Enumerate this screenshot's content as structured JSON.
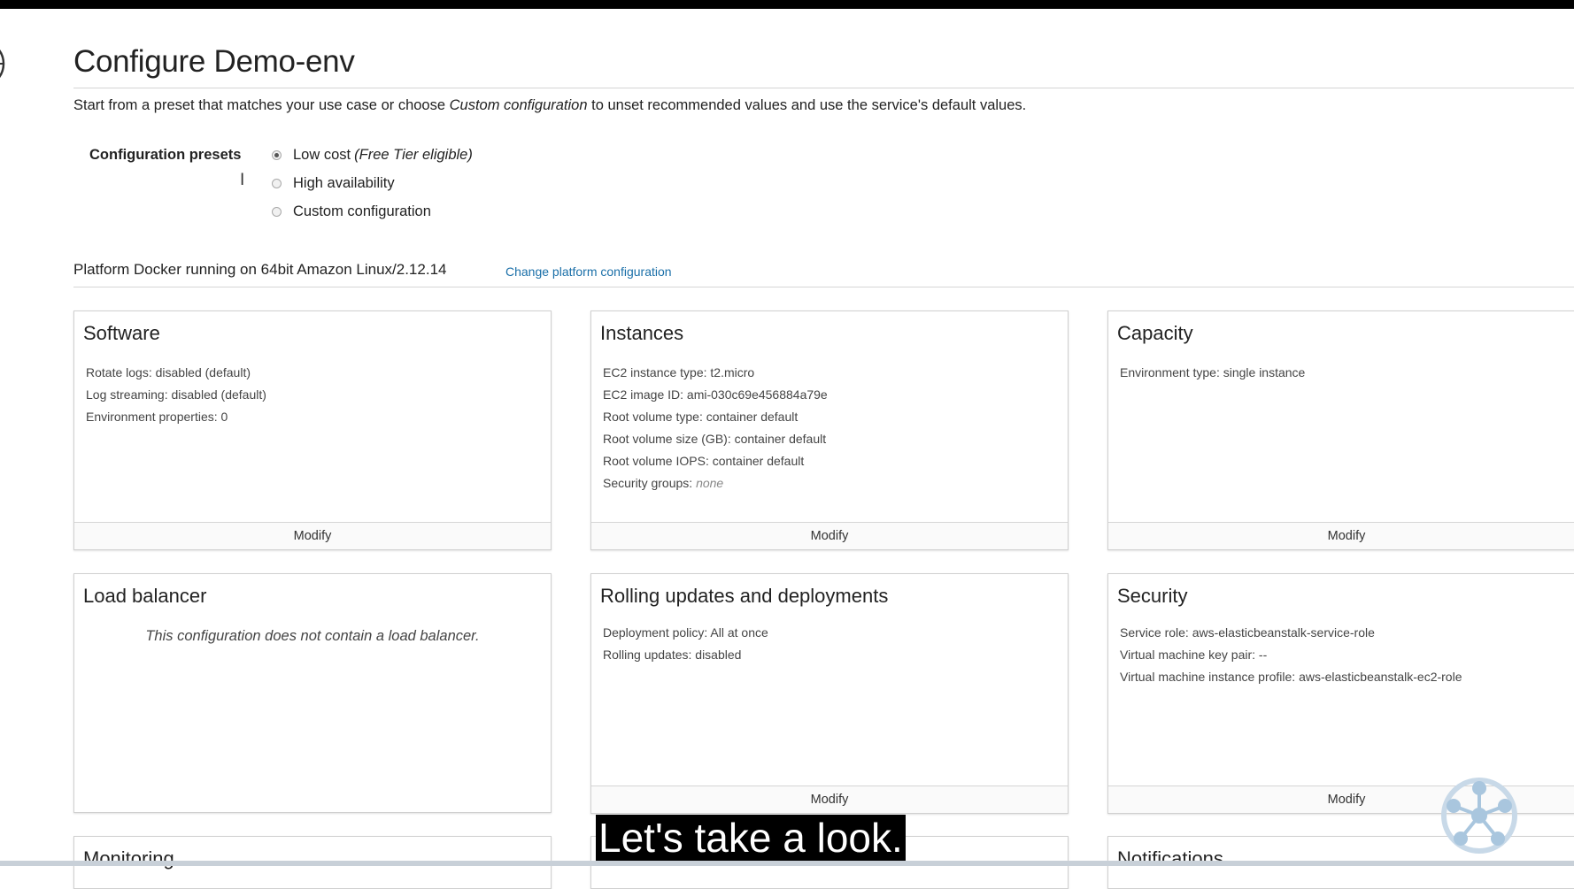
{
  "header": {
    "title": "Configure Demo-env",
    "intro_before": "Start from a preset that matches your use case or choose ",
    "intro_emphasis": "Custom configuration",
    "intro_after": " to unset recommended values and use the service's default values."
  },
  "presets": {
    "label": "Configuration presets",
    "options": [
      {
        "label": "Low cost",
        "note": "(Free Tier eligible)",
        "selected": true
      },
      {
        "label": "High availability",
        "note": "",
        "selected": false
      },
      {
        "label": "Custom configuration",
        "note": "",
        "selected": false
      }
    ]
  },
  "platform": {
    "text": "Platform Docker running on 64bit Amazon Linux/2.12.14",
    "change_link": "Change platform configuration"
  },
  "cards": {
    "software": {
      "title": "Software",
      "lines": [
        "Rotate logs: disabled (default)",
        "Log streaming: disabled (default)",
        "Environment properties: 0"
      ],
      "modify": "Modify"
    },
    "instances": {
      "title": "Instances",
      "lines": [
        "EC2 instance type: t2.micro",
        "EC2 image ID: ami-030c69e456884a79e",
        "Root volume type: container default",
        "Root volume size (GB): container default",
        "Root volume IOPS: container default"
      ],
      "security_prefix": "Security groups: ",
      "security_value": "none",
      "modify": "Modify"
    },
    "capacity": {
      "title": "Capacity",
      "lines": [
        "Environment type: single instance"
      ],
      "modify": "Modify"
    },
    "load_balancer": {
      "title": "Load balancer",
      "note": "This configuration does not contain a load balancer."
    },
    "rolling": {
      "title": "Rolling updates and deployments",
      "lines": [
        "Deployment policy: All at once",
        "Rolling updates: disabled"
      ],
      "modify": "Modify"
    },
    "security": {
      "title": "Security",
      "lines": [
        "Service role: aws-elasticbeanstalk-service-role",
        "Virtual machine key pair: --",
        "Virtual machine instance profile: aws-elasticbeanstalk-ec2-role"
      ],
      "modify": "Modify"
    },
    "monitoring": {
      "title": "Monitoring"
    },
    "notifications": {
      "title": "Notifications"
    }
  },
  "overlay": {
    "subtitle": "Let's take a look."
  },
  "colors": {
    "link": "#1a6fa8",
    "logo": "#a9c6de"
  },
  "icons": [
    "globe-icon",
    "text-cursor-icon",
    "network-logo-icon"
  ]
}
